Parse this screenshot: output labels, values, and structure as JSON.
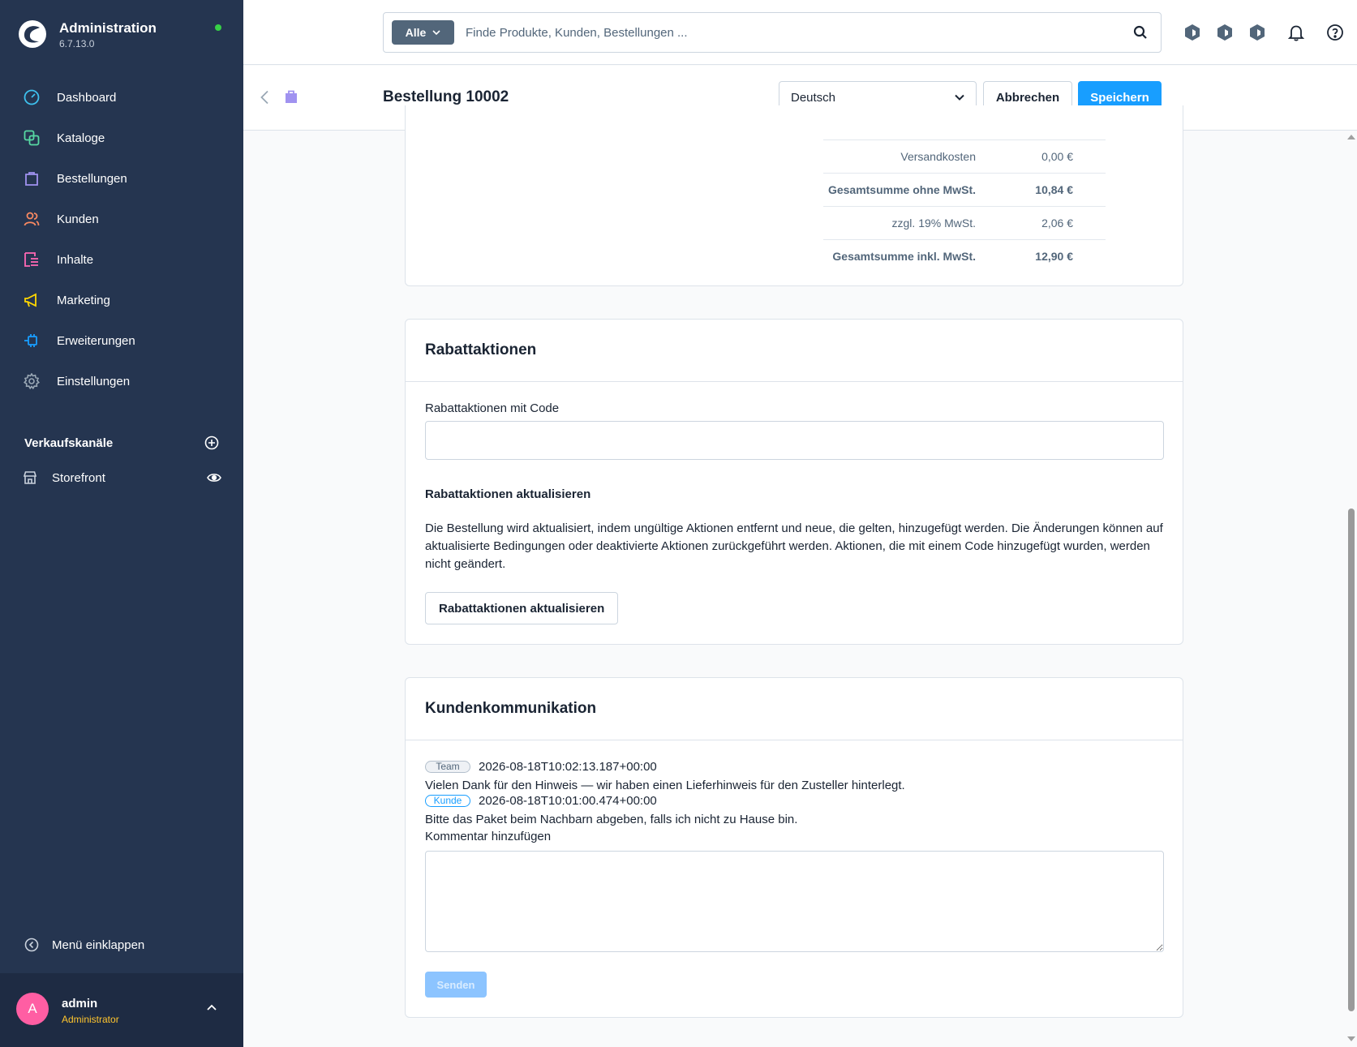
{
  "app": {
    "title": "Administration",
    "version": "6.7.13.0",
    "status_color": "#37d046"
  },
  "sidebar": {
    "items": [
      {
        "label": "Dashboard",
        "icon": "dashboard-icon",
        "color": "#3ec1ee"
      },
      {
        "label": "Kataloge",
        "icon": "catalog-icon",
        "color": "#57d9a3"
      },
      {
        "label": "Bestellungen",
        "icon": "orders-bag-icon",
        "color": "#a092f0"
      },
      {
        "label": "Kunden",
        "icon": "customers-icon",
        "color": "#f88962"
      },
      {
        "label": "Inhalte",
        "icon": "content-icon",
        "color": "#ff68b4"
      },
      {
        "label": "Marketing",
        "icon": "marketing-megaphone-icon",
        "color": "#ffd700"
      },
      {
        "label": "Erweiterungen",
        "icon": "extensions-plug-icon",
        "color": "#189eff"
      },
      {
        "label": "Einstellungen",
        "icon": "settings-gear-icon",
        "color": "#9aa8b5"
      }
    ],
    "channels_title": "Verkaufskanäle",
    "channels": [
      {
        "label": "Storefront"
      }
    ],
    "collapse_label": "Menü einklappen",
    "user": {
      "initial": "A",
      "name": "admin",
      "role": "Administrator"
    }
  },
  "topbar": {
    "search_type": "Alle",
    "search_placeholder": "Finde Produkte, Kunden, Bestellungen ..."
  },
  "smartbar": {
    "title": "Bestellung 10002",
    "language": "Deutsch",
    "cancel_label": "Abbrechen",
    "save_label": "Speichern"
  },
  "summary": {
    "rows": [
      {
        "label": "Versandkosten",
        "value": "0,00 €",
        "bold": false
      },
      {
        "label": "Gesamtsumme ohne MwSt.",
        "value": "10,84 €",
        "bold": true
      },
      {
        "label": "zzgl. 19% MwSt.",
        "value": "2,06 €",
        "bold": false
      },
      {
        "label": "Gesamtsumme inkl. MwSt.",
        "value": "12,90 €",
        "bold": true
      }
    ]
  },
  "promotions": {
    "title": "Rabattaktionen",
    "code_label": "Rabattaktionen mit Code",
    "code_value": "",
    "update_heading": "Rabattaktionen aktualisieren",
    "update_text": "Die Bestellung wird aktualisiert, indem ungültige Aktionen entfernt und neue, die gelten, hinzugefügt werden. Die Änderungen können auf aktualisierte Bedingungen oder deaktivierte Aktionen zurückgeführt werden. Aktionen, die mit einem Code hinzugefügt wurden, werden nicht geändert.",
    "update_button": "Rabattaktionen aktualisieren"
  },
  "communication": {
    "title": "Kundenkommunikation",
    "messages": [
      {
        "badge": "Team",
        "timestamp": "2026-08-18T10:02:13.187+00:00",
        "text": "Vielen Dank für den Hinweis — wir haben einen Lieferhinweis für den Zusteller hinterlegt."
      },
      {
        "badge": "Kunde",
        "timestamp": "2026-08-18T10:01:00.474+00:00",
        "text": "Bitte das Paket beim Nachbarn abgeben, falls ich nicht zu Hause bin."
      }
    ],
    "comment_label": "Kommentar hinzufügen",
    "comment_value": "",
    "send_label": "Senden"
  }
}
